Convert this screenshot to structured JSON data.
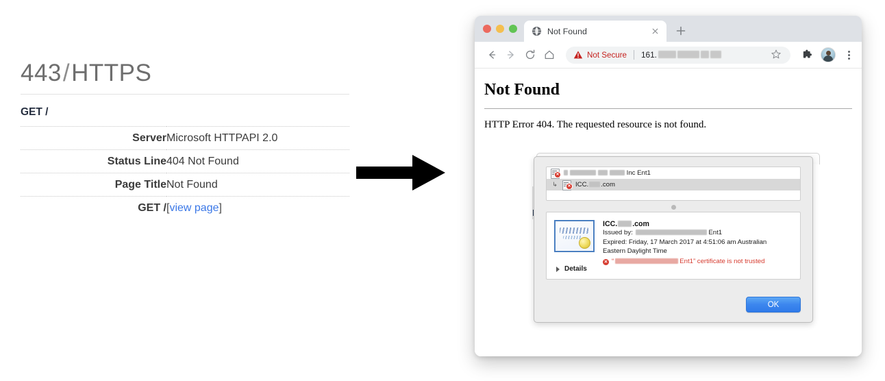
{
  "report": {
    "title_port": "443",
    "title_sep": "/",
    "title_proto": "HTTPS",
    "subtitle": "GET /",
    "rows": [
      {
        "key": "Server",
        "value": "Microsoft HTTPAPI 2.0"
      },
      {
        "key": "Status Line",
        "value": "404 Not Found"
      },
      {
        "key": "Page Title",
        "value": "Not Found"
      }
    ],
    "link_row": {
      "key": "GET /",
      "bracket_open": "[",
      "link_label": "view page",
      "bracket_close": "]"
    },
    "link_color": "#3b78e7",
    "title_color": "#6e6e6e"
  },
  "arrow": {
    "icon": "arrow-right-icon"
  },
  "browser": {
    "traffic_lights": {
      "close": "#ec6a5f",
      "minimize": "#f4bf50",
      "zoom": "#61c454"
    },
    "tab": {
      "favicon": "globe-icon",
      "title": "Not Found",
      "close_icon": "close-icon"
    },
    "new_tab_icon": "plus-icon",
    "toolbar": {
      "back_icon": "arrow-left-icon",
      "forward_icon": "arrow-right-icon",
      "reload_icon": "reload-icon",
      "home_icon": "home-icon",
      "security_icon": "warning-triangle-icon",
      "security_label": "Not Secure",
      "url_text": "161.",
      "url_redacted": true,
      "bookmark_icon": "star-icon",
      "extensions_icon": "puzzle-piece-icon",
      "profile_icon": "avatar-icon",
      "menu_icon": "kebab-menu-icon"
    },
    "page": {
      "heading": "Not Found",
      "body": "HTTP Error 404. The requested resource is not found."
    }
  },
  "cert_dialog": {
    "tree": [
      {
        "label_prefix": "",
        "redacted": true,
        "label_suffix": "Inc Ent1",
        "icon": "certificate-error-icon",
        "selected": false,
        "indent": false
      },
      {
        "label_prefix": "ICC.",
        "redacted": true,
        "label_suffix": ".com",
        "icon": "certificate-error-icon",
        "selected": true,
        "indent": true
      }
    ],
    "splitter_icon": "splitter-grip-icon",
    "detail": {
      "cert_image": "certificate-seal-icon",
      "common_name_prefix": "ICC.",
      "common_name_redacted": true,
      "common_name_suffix": ".com",
      "issued_by_label": "Issued by:",
      "issued_by_redacted": true,
      "issued_by_suffix": "Ent1",
      "expired_line1": "Expired: Friday, 17 March 2017 at 4:51:06 am Australian",
      "expired_line2": "Eastern Daylight Time",
      "untrusted_icon": "error-circle-icon",
      "untrusted_quote_open": "“",
      "untrusted_redacted": true,
      "untrusted_suffix": "Ent1” certificate is not trusted"
    },
    "details_disclosure": {
      "icon": "disclosure-triangle-icon",
      "label": "Details"
    },
    "ok_button": "OK"
  }
}
